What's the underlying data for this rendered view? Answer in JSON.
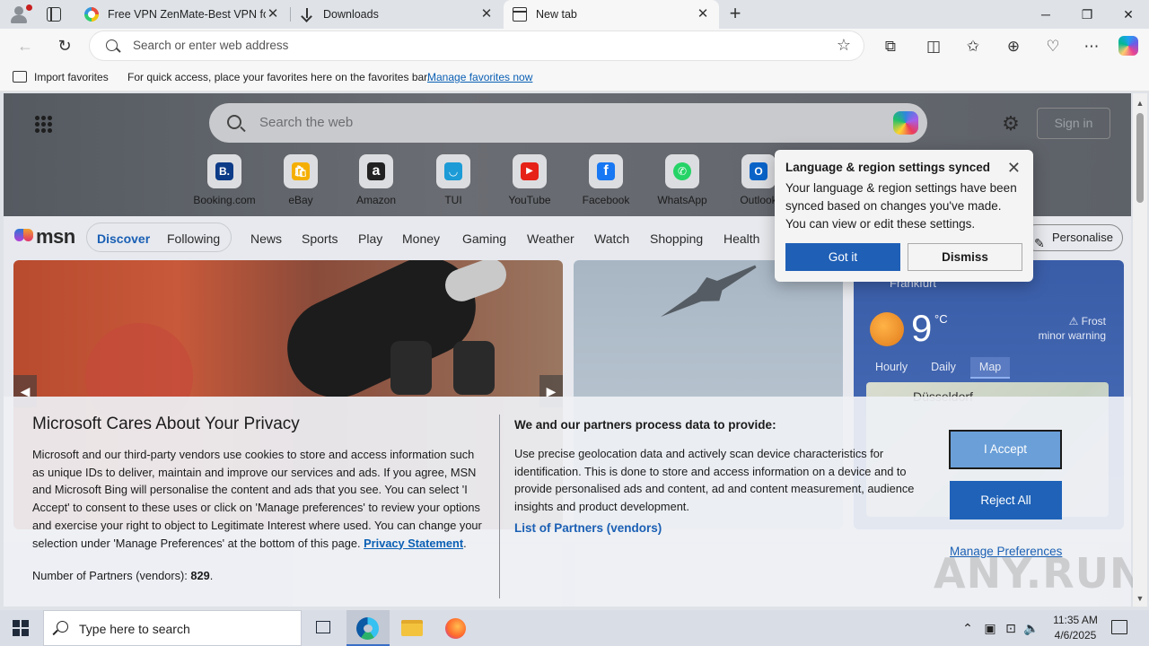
{
  "browser": {
    "tabs": [
      {
        "title": "Free VPN ZenMate-Best VPN for",
        "icon": "zenmate-favicon"
      },
      {
        "title": "Downloads",
        "icon": "download-icon"
      },
      {
        "title": "New tab",
        "icon": "new-tab-icon"
      }
    ],
    "address_placeholder": "Search or enter web address",
    "window_controls": {
      "minimize": "─",
      "restore": "❐",
      "close": "✕"
    }
  },
  "favorites_bar": {
    "import_label": "Import favorites",
    "hint": "For quick access, place your favorites here on the favorites bar.",
    "manage_link": "Manage favorites now"
  },
  "newtab": {
    "search_placeholder": "Search the web",
    "signin_label": "Sign in",
    "tiles": [
      {
        "label": "Booking.com",
        "glyph": "B.",
        "color": "#0c3b87"
      },
      {
        "label": "eBay",
        "glyph": "🛍",
        "color": "#e53238"
      },
      {
        "label": "Amazon",
        "glyph": "a",
        "color": "#222222"
      },
      {
        "label": "TUI",
        "glyph": "◡",
        "color": "#1c9bd6"
      },
      {
        "label": "YouTube",
        "glyph": "▶",
        "color": "#e62117"
      },
      {
        "label": "Facebook",
        "glyph": "f",
        "color": "#1877f2"
      },
      {
        "label": "WhatsApp",
        "glyph": "✆",
        "color": "#25d366"
      },
      {
        "label": "Outlook",
        "glyph": "O",
        "color": "#0a64c8"
      }
    ]
  },
  "msn": {
    "logo_text": "msn",
    "nav": [
      "Discover",
      "Following",
      "News",
      "Sports",
      "Play",
      "Money",
      "Gaming",
      "Weather",
      "Watch",
      "Shopping",
      "Health"
    ],
    "personalise_label": "Personalise"
  },
  "weather": {
    "city": "Frankfurt",
    "temperature": "9",
    "unit": "°C",
    "warning_title": "Frost",
    "warning_sub": "minor warning",
    "tabs": [
      "Hourly",
      "Daily",
      "Map"
    ],
    "selected_tab": "Map",
    "map_city": "Düsseldorf"
  },
  "language_popup": {
    "title": "Language & region settings synced",
    "body": "Your language & region settings have been synced based on changes you've made. You can view or edit these settings.",
    "got_it": "Got it",
    "dismiss": "Dismiss"
  },
  "privacy": {
    "title": "Microsoft Cares About Your Privacy",
    "body": "Microsoft and our third-party vendors use cookies to store and access information such as unique IDs to deliver, maintain and improve our services and ads. If you agree, MSN and Microsoft Bing will personalise the content and ads that you see. You can select 'I Accept' to consent to these uses or click on 'Manage preferences' to review your options and exercise your right to object to Legitimate Interest where used. You can change your selection under 'Manage Preferences' at the bottom of this page.",
    "privacy_link": "Privacy Statement",
    "partners_label": "Number of Partners (vendors):",
    "partners_count": "829",
    "right_title": "We and our partners process data to provide:",
    "right_body": "Use precise geolocation data and actively scan device characteristics for identification. This is done to store and access information on a device and to provide personalised ads and content, ad and content measurement, audience insights and product development.",
    "partners_link": "List of Partners (vendors)",
    "accept": "I Accept",
    "reject": "Reject All",
    "manage": "Manage Preferences"
  },
  "watermark": "ANY.RUN",
  "taskbar": {
    "search_placeholder": "Type here to search",
    "time": "11:35 AM",
    "date": "4/6/2025"
  },
  "colors": {
    "accent": "#1f5fb6",
    "weather_bg": "#3a5da8"
  }
}
